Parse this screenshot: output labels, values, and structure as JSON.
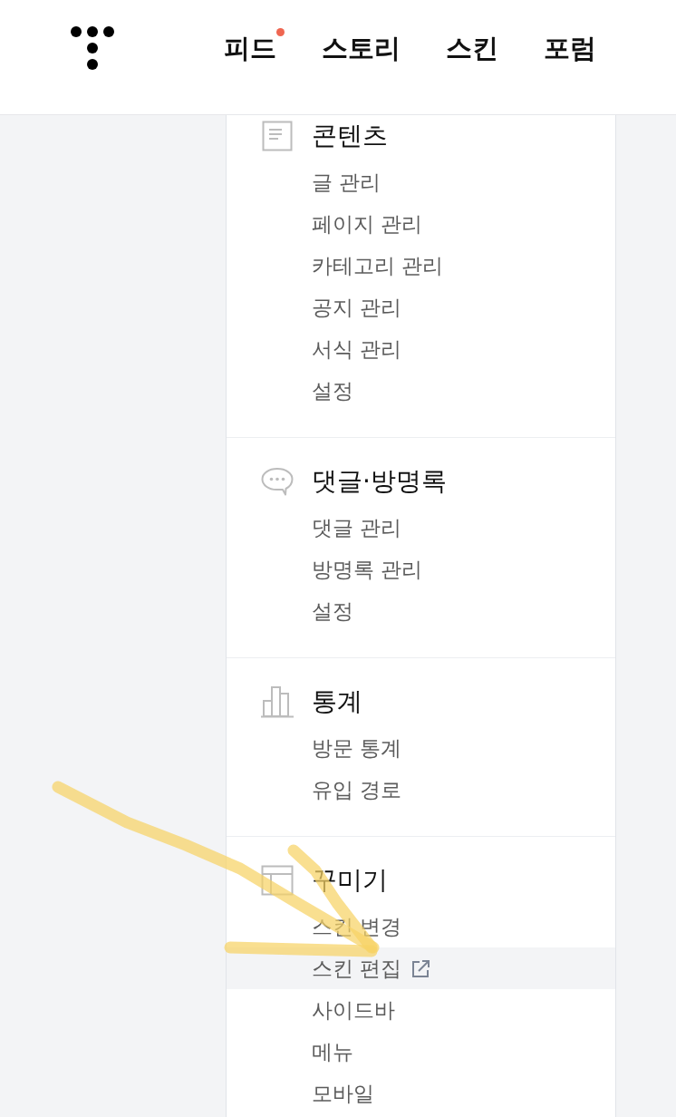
{
  "header": {
    "nav": [
      {
        "label": "피드",
        "new": true
      },
      {
        "label": "스토리",
        "new": false
      },
      {
        "label": "스킨",
        "new": false
      },
      {
        "label": "포럼",
        "new": false
      }
    ]
  },
  "sections": [
    {
      "kind": "document",
      "title": "콘텐츠",
      "items": [
        {
          "label": "글 관리",
          "selected": false,
          "external": false
        },
        {
          "label": "페이지 관리",
          "selected": false,
          "external": false
        },
        {
          "label": "카테고리 관리",
          "selected": false,
          "external": false
        },
        {
          "label": "공지 관리",
          "selected": false,
          "external": false
        },
        {
          "label": "서식 관리",
          "selected": false,
          "external": false
        },
        {
          "label": "설정",
          "selected": false,
          "external": false
        }
      ]
    },
    {
      "kind": "speech",
      "title": "댓글·방명록",
      "items": [
        {
          "label": "댓글 관리",
          "selected": false,
          "external": false
        },
        {
          "label": "방명록 관리",
          "selected": false,
          "external": false
        },
        {
          "label": "설정",
          "selected": false,
          "external": false
        }
      ]
    },
    {
      "kind": "chart",
      "title": "통계",
      "items": [
        {
          "label": "방문 통계",
          "selected": false,
          "external": false
        },
        {
          "label": "유입 경로",
          "selected": false,
          "external": false
        }
      ]
    },
    {
      "kind": "layout",
      "title": "꾸미기",
      "items": [
        {
          "label": "스킨 변경",
          "selected": false,
          "external": false
        },
        {
          "label": "스킨 편집",
          "selected": true,
          "external": true
        },
        {
          "label": "사이드바",
          "selected": false,
          "external": false
        },
        {
          "label": "메뉴",
          "selected": false,
          "external": false
        },
        {
          "label": "모바일",
          "selected": false,
          "external": false
        }
      ]
    }
  ]
}
